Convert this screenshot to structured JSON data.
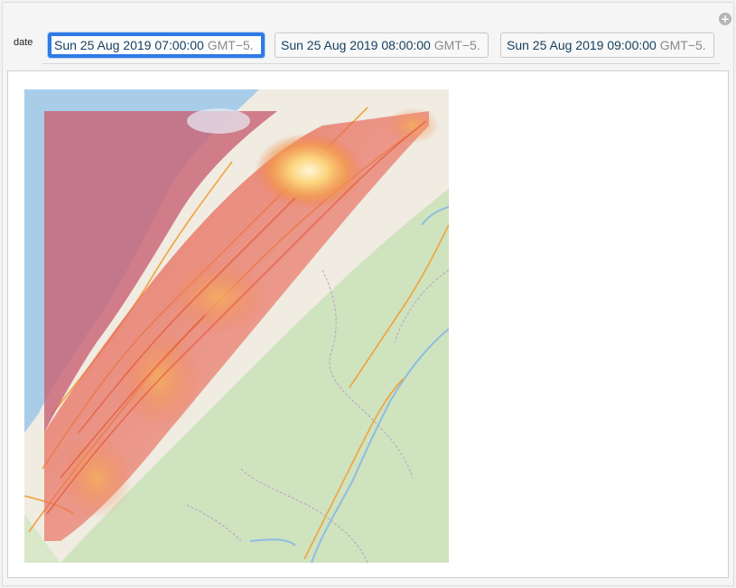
{
  "control": {
    "label": "date",
    "options": [
      {
        "date": "Sun 25 Aug 2019 07:00:00",
        "tz": "GMT−5.",
        "selected": true
      },
      {
        "date": "Sun 25 Aug 2019 08:00:00",
        "tz": "GMT−5.",
        "selected": false
      },
      {
        "date": "Sun 25 Aug 2019 09:00:00",
        "tz": "GMT−5.",
        "selected": false
      }
    ]
  },
  "toolbar": {
    "add_icon": "plus-circle-icon"
  },
  "map": {
    "basemap": "street-map",
    "overlay": "density-heatmap",
    "colors": {
      "water": "#a9cde8",
      "forest": "#cfe3bf",
      "land": "#f0ece2",
      "roads": "#f2a23a",
      "borders": "#b89ab8",
      "heat_low": "#d06a6a",
      "heat_high": "#fff6c8",
      "selection_accent": "#2f7ae5"
    }
  }
}
